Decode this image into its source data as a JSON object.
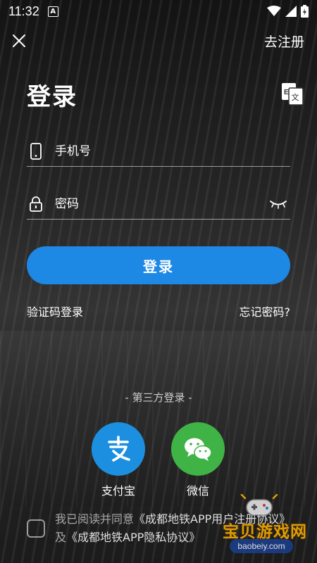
{
  "status_bar": {
    "time": "11:32",
    "notification_letter": "A"
  },
  "top_bar": {
    "register_label": "去注册"
  },
  "title": "登录",
  "phone_field": {
    "placeholder": "手机号"
  },
  "password_field": {
    "placeholder": "密码"
  },
  "login_button_label": "登录",
  "links": {
    "sms_login": "验证码登录",
    "forgot_password": "忘记密码?"
  },
  "third_party": {
    "title": "- 第三方登录 -",
    "items": [
      {
        "label": "支付宝",
        "icon": "alipay-icon",
        "color": "#1d8fe0"
      },
      {
        "label": "微信",
        "icon": "wechat-icon",
        "color": "#3fb345"
      }
    ]
  },
  "agreement": {
    "prefix": "我已阅读并同意",
    "user_agreement": "《成都地铁APP用户注册协议》",
    "connector": "及",
    "privacy_policy": "《成都地铁APP隐私协议》"
  },
  "watermark": {
    "title": "宝贝游戏网",
    "url": "baobeiy.com"
  },
  "colors": {
    "primary": "#1e88e5",
    "alipay": "#1d8fe0",
    "wechat": "#3fb345"
  }
}
